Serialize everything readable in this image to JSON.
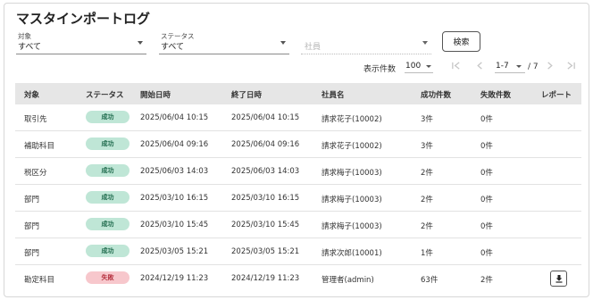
{
  "page": {
    "title": "マスタインポートログ"
  },
  "filters": {
    "target": {
      "label": "対象",
      "value": "すべて"
    },
    "status": {
      "label": "ステータス",
      "value": "すべて"
    },
    "employee": {
      "placeholder": "社員"
    },
    "search_label": "検索"
  },
  "pagination": {
    "per_page_label": "表示件数",
    "per_page_value": "100",
    "range": "1-7",
    "total": "/ 7"
  },
  "table": {
    "headers": [
      "対象",
      "ステータス",
      "開始日時",
      "終了日時",
      "社員名",
      "成功件数",
      "失敗件数",
      "レポート"
    ],
    "rows": [
      {
        "target": "取引先",
        "status": "成功",
        "status_type": "success",
        "start": "2025/06/04 10:15",
        "end": "2025/06/04 10:15",
        "employee": "請求花子(10002)",
        "success": "3件",
        "fail": "0件",
        "report": false
      },
      {
        "target": "補助科目",
        "status": "成功",
        "status_type": "success",
        "start": "2025/06/04 09:16",
        "end": "2025/06/04 09:16",
        "employee": "請求花子(10002)",
        "success": "3件",
        "fail": "0件",
        "report": false
      },
      {
        "target": "税区分",
        "status": "成功",
        "status_type": "success",
        "start": "2025/06/03 14:03",
        "end": "2025/06/03 14:03",
        "employee": "請求梅子(10003)",
        "success": "2件",
        "fail": "0件",
        "report": false
      },
      {
        "target": "部門",
        "status": "成功",
        "status_type": "success",
        "start": "2025/03/10 16:15",
        "end": "2025/03/10 16:15",
        "employee": "請求梅子(10003)",
        "success": "2件",
        "fail": "0件",
        "report": false
      },
      {
        "target": "部門",
        "status": "成功",
        "status_type": "success",
        "start": "2025/03/10 15:45",
        "end": "2025/03/10 15:45",
        "employee": "請求梅子(10003)",
        "success": "2件",
        "fail": "0件",
        "report": false
      },
      {
        "target": "部門",
        "status": "成功",
        "status_type": "success",
        "start": "2025/03/05 15:21",
        "end": "2025/03/05 15:21",
        "employee": "請求次郎(10001)",
        "success": "1件",
        "fail": "0件",
        "report": false
      },
      {
        "target": "勘定科目",
        "status": "失敗",
        "status_type": "fail",
        "start": "2024/12/19 11:23",
        "end": "2024/12/19 11:23",
        "employee": "管理者(admin)",
        "success": "63件",
        "fail": "2件",
        "report": true
      }
    ]
  },
  "colors": {
    "success_bg": "#bfe6d6",
    "success_text": "#1f6b4d",
    "fail_bg": "#f7c7cc",
    "fail_text": "#b4303e",
    "header_bg": "#e6e6e6"
  },
  "icons": {
    "first": "first-page-icon",
    "prev": "prev-page-icon",
    "next": "next-page-icon",
    "last": "last-page-icon",
    "report": "download-icon"
  }
}
